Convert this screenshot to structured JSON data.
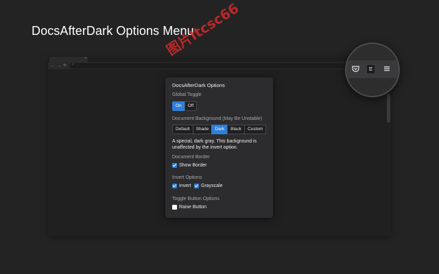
{
  "headline": "DocsAfterDark Options Menu",
  "watermark": "图片Itcsc66",
  "browser": {
    "nav_back": "←",
    "nav_forward": "→",
    "nav_reload": "↻",
    "tab_close": "×"
  },
  "panel": {
    "title": "DocsAfterDark Options",
    "global_toggle": {
      "label": "Global Toggle",
      "options": [
        "On",
        "Off"
      ],
      "selected": "On"
    },
    "document_background": {
      "label": "Document Background (May Be Unstable)",
      "options": [
        "Default",
        "Shade",
        "Dark",
        "Black",
        "Custom"
      ],
      "selected": "Dark",
      "description": "A special, dark gray. This background is unaffected by the invert option."
    },
    "document_border": {
      "label": "Document Border",
      "show_border": {
        "label": "Show Border",
        "checked": true
      }
    },
    "invert_options": {
      "label": "Invert Options",
      "invert": {
        "label": "Invert",
        "checked": true
      },
      "grayscale": {
        "label": "Grayscale",
        "checked": true
      }
    },
    "toggle_button_options": {
      "label": "Toggle Button Options",
      "raise_button": {
        "label": "Raise Button",
        "checked": false
      }
    }
  },
  "toolbar_icons": [
    "pocket-icon",
    "docsafterdark-icon",
    "hamburger-menu-icon"
  ],
  "colors": {
    "accent": "#2f7fd8",
    "panel_bg": "#2c2c2e",
    "page_bg": "#232323",
    "watermark": "#d42a2a"
  }
}
